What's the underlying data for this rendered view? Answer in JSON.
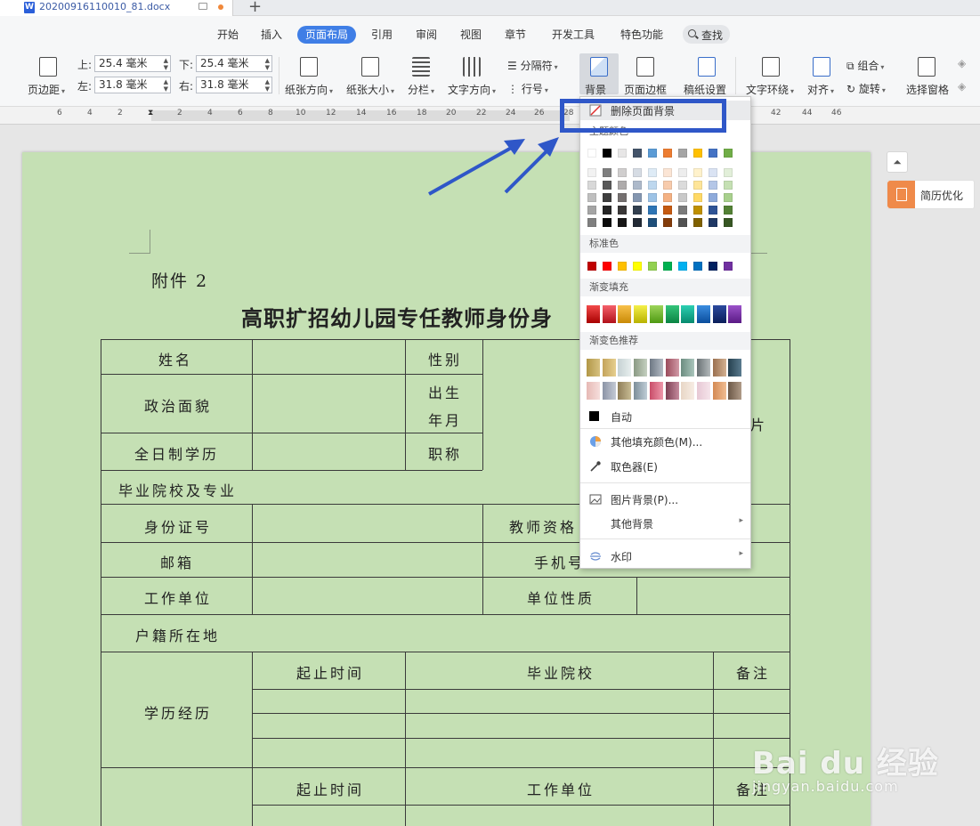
{
  "titlebar": {
    "doc_name": "20200916110010_81.docx",
    "new_tab": "+"
  },
  "menu": {
    "items": [
      "开始",
      "插入",
      "页面布局",
      "引用",
      "审阅",
      "视图",
      "章节",
      "开发工具",
      "特色功能"
    ],
    "active": "页面布局",
    "search_label": "查找"
  },
  "ribbon": {
    "margins_label": "页边距",
    "top_label": "上:",
    "top_value": "25.4 毫米",
    "bottom_label": "下:",
    "bottom_value": "25.4 毫米",
    "left_label": "左:",
    "left_value": "31.8 毫米",
    "right_label": "右:",
    "right_value": "31.8 毫米",
    "orientation": "纸张方向",
    "size": "纸张大小",
    "columns": "分栏",
    "text_direction": "文字方向",
    "breaks": "分隔符",
    "line_numbers": "行号",
    "background": "背景",
    "page_border": "页面边框",
    "manuscript": "稿纸设置",
    "wrap": "文字环绕",
    "align": "对齐",
    "group": "组合",
    "rotate": "旋转",
    "selection_pane": "选择窗格"
  },
  "ruler": {
    "numbers": [
      "6",
      "4",
      "2",
      "2",
      "4",
      "6",
      "8",
      "10",
      "12",
      "14",
      "16",
      "18",
      "20",
      "22",
      "24",
      "26",
      "28",
      "42",
      "44",
      "46"
    ]
  },
  "document": {
    "attachment": "附件 2",
    "title": "高职扩招幼儿园专任教师身份",
    "title_cut": "身",
    "rows": {
      "name": "姓名",
      "gender": "性别",
      "political": "政治面貌",
      "birth_a": "出生",
      "birth_b": "年月",
      "photo": "片",
      "education": "全日制学历",
      "title": "职称",
      "school_major": "毕业院校及专业",
      "id": "身份证号",
      "teacher_cert": "教师资格",
      "email": "邮箱",
      "phone": "手机号",
      "work_unit": "工作单位",
      "unit_nature": "单位性质",
      "household": "户籍所在地",
      "edu_history": "学历经历",
      "start_end": "起止时间",
      "grad_school": "毕业院校",
      "note": "备注",
      "start_end2": "起止时间",
      "work_unit2": "工作单位",
      "note2": "备注"
    }
  },
  "side": {
    "resume_label": "简历优化"
  },
  "dropdown": {
    "remove_bg": "删除页面背景",
    "theme_colors": "主题颜色",
    "standard_colors": "标准色",
    "gradient_fill": "渐变填充",
    "gradient_recommend": "渐变色推荐",
    "auto": "自动",
    "more_fill": "其他填充颜色(M)...",
    "eyedropper": "取色器(E)",
    "picture_bg": "图片背景(P)...",
    "other_bg": "其他背景",
    "watermark": "水印",
    "theme_top": [
      "#ffffff",
      "#000000",
      "#e7e6e6",
      "#44546a",
      "#5b9bd5",
      "#ed7d31",
      "#a5a5a5",
      "#ffc000",
      "#4472c4",
      "#70ad47"
    ],
    "theme_shades": [
      [
        "#f2f2f2",
        "#7f7f7f",
        "#d0cece",
        "#d6dce4",
        "#deebf6",
        "#fbe5d5",
        "#ededed",
        "#fff2cc",
        "#dae3f3",
        "#e2efd9"
      ],
      [
        "#d8d8d8",
        "#595959",
        "#aeabab",
        "#adb9ca",
        "#bdd7ee",
        "#f7cbac",
        "#dbdbdb",
        "#fee599",
        "#b4c6e7",
        "#c5e0b3"
      ],
      [
        "#bfbfbf",
        "#3f3f3f",
        "#757070",
        "#8496b0",
        "#9dc3e6",
        "#f4b183",
        "#c9c9c9",
        "#ffd965",
        "#8eaadb",
        "#a8d08d"
      ],
      [
        "#a5a5a5",
        "#262626",
        "#3a3838",
        "#323f4f",
        "#2e75b5",
        "#c55a11",
        "#7b7b7b",
        "#bf9000",
        "#2f5496",
        "#538135"
      ],
      [
        "#7f7f7f",
        "#0c0c0c",
        "#171616",
        "#222a35",
        "#1e4e79",
        "#833c0b",
        "#525252",
        "#7f6000",
        "#1f3864",
        "#375623"
      ]
    ],
    "standard": [
      "#c00000",
      "#ff0000",
      "#ffc000",
      "#ffff00",
      "#92d050",
      "#00b050",
      "#00b0f0",
      "#0070c0",
      "#002060",
      "#7030a0"
    ],
    "gradients": [
      [
        "#f24a4a",
        "#a80000"
      ],
      [
        "#f5616b",
        "#b1111a"
      ],
      [
        "#f8c14b",
        "#c98a06"
      ],
      [
        "#f4f04a",
        "#b8b200"
      ],
      [
        "#9dd45a",
        "#4f9a12"
      ],
      [
        "#34c47a",
        "#0a8443"
      ],
      [
        "#2ccfb2",
        "#078a6e"
      ],
      [
        "#3b8de0",
        "#0a4d9c"
      ],
      [
        "#2b4a9e",
        "#0b1e5a"
      ],
      [
        "#9b52c9",
        "#5a1a85"
      ]
    ],
    "recommend": [
      [
        "#b29747",
        "#d6c180"
      ],
      [
        "#c4a45c",
        "#e6cf8f"
      ],
      [
        "#c6d2d3",
        "#e7eeee"
      ],
      [
        "#8a9a84",
        "#c5d0c0"
      ],
      [
        "#6e7884",
        "#b3bbc4"
      ],
      [
        "#9b4b5c",
        "#d19aa6"
      ],
      [
        "#6c8c80",
        "#aac6bc"
      ],
      [
        "#6a7275",
        "#b3b9bb"
      ],
      [
        "#9a7050",
        "#d3b192"
      ],
      [
        "#26404f",
        "#5a7b8e"
      ],
      [
        "#e7b9b5",
        "#f5dedc"
      ],
      [
        "#8b94a6",
        "#c4cad5"
      ],
      [
        "#8e7e58",
        "#c8bb93"
      ],
      [
        "#7c8e99",
        "#bfcdd6"
      ],
      [
        "#c94e6a",
        "#ee97aa"
      ],
      [
        "#7c3f53",
        "#c58a9d"
      ],
      [
        "#e8d6c6",
        "#f7ede4"
      ],
      [
        "#e7c8d4",
        "#f5e4eb"
      ],
      [
        "#d48a54",
        "#f0bd92"
      ],
      [
        "#6b5847",
        "#b09b88"
      ]
    ]
  },
  "watermark": {
    "main": "Bai du 经验",
    "sub": "jingyan.baidu.com"
  }
}
